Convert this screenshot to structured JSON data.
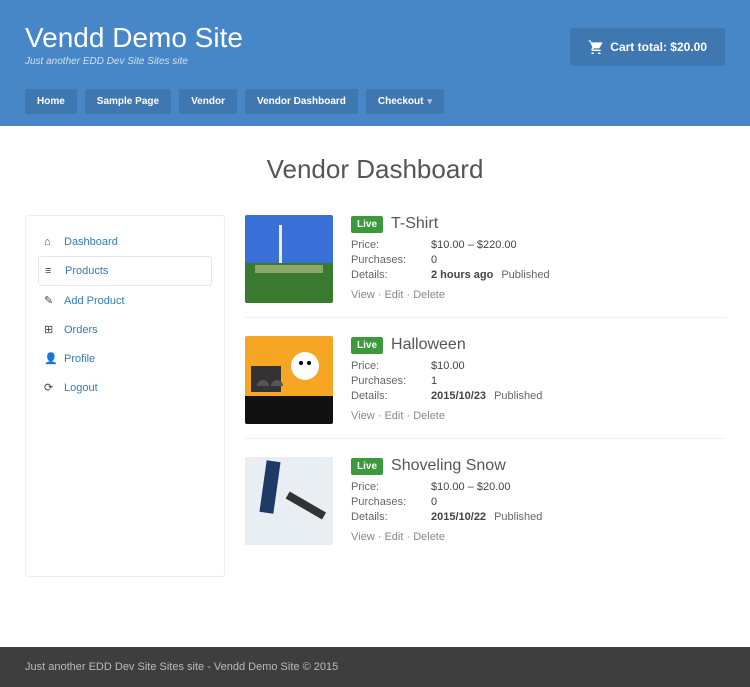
{
  "site": {
    "title": "Vendd Demo Site",
    "tagline": "Just another EDD Dev Site Sites site"
  },
  "cart": {
    "label": "Cart total: $20.00"
  },
  "nav": {
    "home": "Home",
    "sample": "Sample Page",
    "vendor": "Vendor",
    "dashboard": "Vendor Dashboard",
    "checkout": "Checkout"
  },
  "page": {
    "title": "Vendor Dashboard"
  },
  "sidebar": {
    "dashboard": "Dashboard",
    "products": "Products",
    "add_product": "Add Product",
    "orders": "Orders",
    "profile": "Profile",
    "logout": "Logout"
  },
  "labels": {
    "price": "Price:",
    "purchases": "Purchases:",
    "details": "Details:",
    "view": "View",
    "edit": "Edit",
    "delete": "Delete",
    "sep": " · "
  },
  "badge": {
    "live": "Live"
  },
  "products": [
    {
      "title": "T-Shirt",
      "price": "$10.00 – $220.00",
      "purchases": "0",
      "details_time": "2 hours ago",
      "details_status": "Published"
    },
    {
      "title": "Halloween",
      "price": "$10.00",
      "purchases": "1",
      "details_time": "2015/10/23",
      "details_status": "Published"
    },
    {
      "title": "Shoveling Snow",
      "price": "$10.00 – $20.00",
      "purchases": "0",
      "details_time": "2015/10/22",
      "details_status": "Published"
    }
  ],
  "footer": {
    "text": "Just another EDD Dev Site Sites site - Vendd Demo Site © 2015"
  }
}
